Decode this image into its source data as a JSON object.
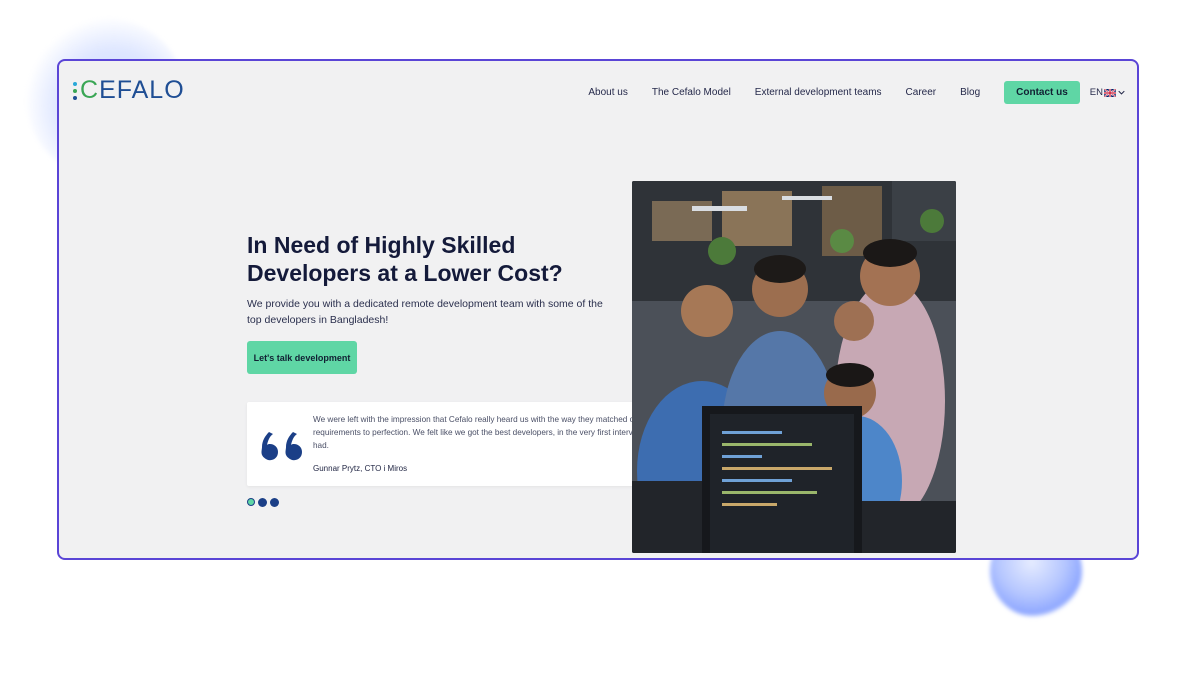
{
  "brand": {
    "name": "CEFALO",
    "first_letter": "C",
    "rest": "EFALO",
    "dot_colors": [
      "#2aa8d8",
      "#3aa655",
      "#1f4e94"
    ]
  },
  "nav": {
    "items": [
      "About us",
      "The Cefalo Model",
      "External development teams",
      "Career",
      "Blog"
    ],
    "contact_label": "Contact us",
    "language": "EN",
    "flag_icon": "uk-flag-icon"
  },
  "hero": {
    "title": "In Need of Highly Skilled Developers at a Lower Cost?",
    "subtitle": "We provide you with a dedicated remote development team with some of the top developers in Bangladesh!",
    "cta_label": "Let's talk development"
  },
  "testimonial": {
    "quote": "We were left with the impression that Cefalo really heard us with the way they matched our requirements to perfection. We felt like we got the best developers, in the very first interview we had.",
    "author": "Gunnar Prytz, CTO i Miros",
    "slides_total": 3,
    "active_slide": 1
  },
  "colors": {
    "accent": "#5fd6a5",
    "frame_border": "#5a45d6",
    "navy": "#1b3f87"
  }
}
